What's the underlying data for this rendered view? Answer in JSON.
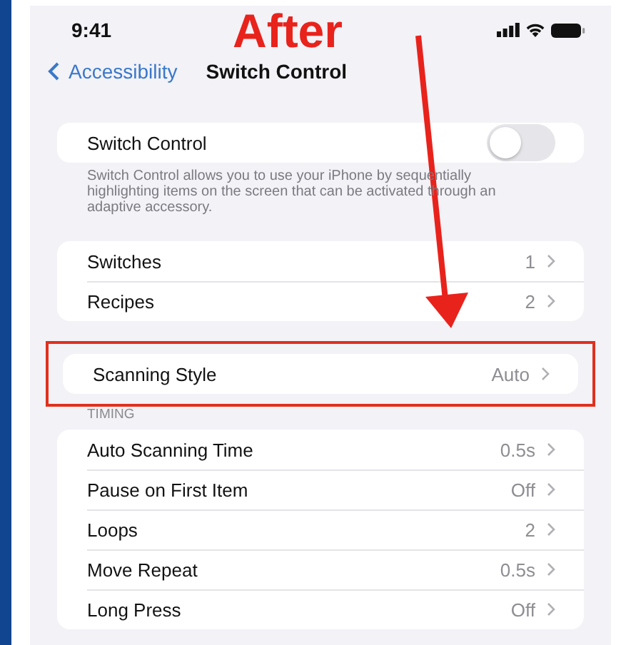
{
  "annotation": {
    "label": "After"
  },
  "status_bar": {
    "time": "9:41"
  },
  "nav": {
    "back": "Accessibility",
    "title": "Switch Control"
  },
  "switch_control": {
    "label": "Switch Control",
    "on": false,
    "footer": "Switch Control allows you to use your iPhone by sequentially highlighting items on the screen that can be activated through an adaptive accessory."
  },
  "groups": [
    {
      "highlighted": false,
      "rows": [
        {
          "label": "Switches",
          "value": "1"
        },
        {
          "label": "Recipes",
          "value": "2"
        }
      ]
    },
    {
      "highlighted": true,
      "rows": [
        {
          "label": "Scanning Style",
          "value": "Auto"
        }
      ]
    },
    {
      "header": "TIMING",
      "highlighted": false,
      "rows": [
        {
          "label": "Auto Scanning Time",
          "value": "0.5s"
        },
        {
          "label": "Pause on First Item",
          "value": "Off"
        },
        {
          "label": "Loops",
          "value": "2"
        },
        {
          "label": "Move Repeat",
          "value": "0.5s"
        },
        {
          "label": "Long Press",
          "value": "Off"
        }
      ]
    }
  ]
}
